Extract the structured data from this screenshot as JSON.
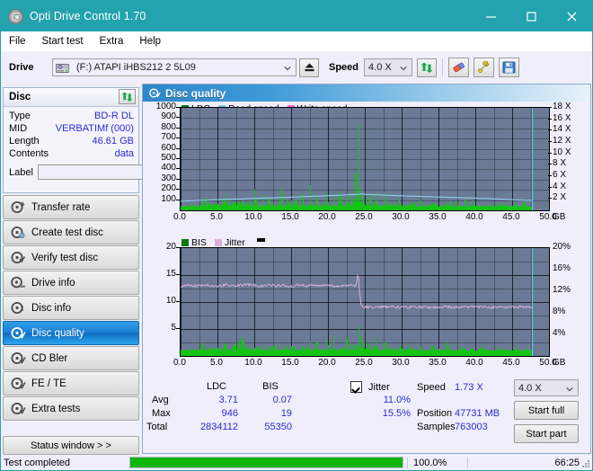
{
  "window": {
    "title": "Opti Drive Control 1.70",
    "icon": "disc-icon",
    "minimize": "−",
    "maximize": "□",
    "close": "✕"
  },
  "menu": {
    "items": [
      "File",
      "Start test",
      "Extra",
      "Help"
    ]
  },
  "toolbar": {
    "drive_label": "Drive",
    "drive_value": "(F:)  ATAPI iHBS212  2 5L09",
    "eject_icon": "eject-icon",
    "speed_label": "Speed",
    "speed_value": "4.0 X",
    "refresh_icon": "refresh-icon",
    "erase_icon": "eraser-icon",
    "tools_icon": "tools-icon",
    "save_icon": "save-icon"
  },
  "disc_panel": {
    "title": "Disc",
    "refresh_icon": "refresh-icon",
    "rows": [
      {
        "key": "Type",
        "value": "BD-R DL"
      },
      {
        "key": "MID",
        "value": "VERBATIMf (000)"
      },
      {
        "key": "Length",
        "value": "46.61 GB"
      },
      {
        "key": "Contents",
        "value": "data"
      }
    ],
    "label_key": "Label",
    "label_value": "",
    "label_placeholder": "",
    "label_button_icon": "disc-yellow-icon"
  },
  "sidebar": {
    "items": [
      {
        "label": "Transfer rate",
        "icon": "disc-arrow-icon",
        "selected": false
      },
      {
        "label": "Create test disc",
        "icon": "disc-write-icon",
        "selected": false
      },
      {
        "label": "Verify test disc",
        "icon": "disc-verify-icon",
        "selected": false
      },
      {
        "label": "Drive info",
        "icon": "drive-info-icon",
        "selected": false
      },
      {
        "label": "Disc info",
        "icon": "disc-info-icon",
        "selected": false
      },
      {
        "label": "Disc quality",
        "icon": "disc-quality-icon",
        "selected": true
      },
      {
        "label": "CD Bler",
        "icon": "disc-bler-icon",
        "selected": false
      },
      {
        "label": "FE / TE",
        "icon": "disc-fete-icon",
        "selected": false
      },
      {
        "label": "Extra tests",
        "icon": "disc-extra-icon",
        "selected": false
      }
    ],
    "status_window_button": "Status window > >"
  },
  "main": {
    "title": "Disc quality",
    "icon": "disc-quality-icon"
  },
  "stats": {
    "col_headers": [
      "LDC",
      "BIS"
    ],
    "row_headers": [
      "Avg",
      "Max",
      "Total"
    ],
    "ldc": {
      "avg": "3.71",
      "max": "946",
      "total": "2834112"
    },
    "bis": {
      "avg": "0.07",
      "max": "19",
      "total": "55350"
    },
    "jitter": {
      "label": "Jitter",
      "checked": true,
      "avg": "11.0%",
      "max": "15.5%"
    },
    "speed_label": "Speed",
    "speed_value": "1.73 X",
    "position_label": "Position",
    "position_value": "47731 MB",
    "samples_label": "Samples",
    "samples_value": "763003",
    "speed_select": "4.0 X",
    "start_full_button": "Start full",
    "start_part_button": "Start part"
  },
  "statusbar": {
    "message": "Test completed",
    "progress_percent": "100.0%",
    "progress_value": 100,
    "elapsed": "66:25"
  },
  "colors": {
    "accent": "#23a3ae",
    "ldc": "#14c414",
    "bis": "#14c414",
    "read_speed": "#8fd8f5",
    "write_speed": "#ff66dd",
    "jitter": "#d9b0d9",
    "value_text": "#2b2bd4",
    "plot_bg": "#6b7a96",
    "progress": "#0fb40f"
  },
  "chart_data": [
    {
      "type": "bar",
      "id": "ldc-chart",
      "title": "Disc quality",
      "legend": [
        {
          "label": "LDC",
          "color": "#0a7a0a"
        },
        {
          "label": "Read speed",
          "color": "#6fc8f0"
        },
        {
          "label": "Write speed",
          "color": "#ff66dd"
        }
      ],
      "legend_position": "top-left",
      "xlabel": "GB",
      "x_unit_label": "50.0 GB",
      "xlim": [
        0,
        50
      ],
      "xticks": [
        "0.0",
        "5.0",
        "10.0",
        "15.0",
        "20.0",
        "25.0",
        "30.0",
        "35.0",
        "40.0",
        "45.0",
        "50.0"
      ],
      "ylabel": "LDC",
      "ylim": [
        0,
        1000
      ],
      "yticks": [
        100,
        200,
        300,
        400,
        500,
        600,
        700,
        800,
        900,
        1000
      ],
      "y2label": "Speed",
      "y2lim": [
        0,
        18
      ],
      "y2ticks": [
        "2 X",
        "4 X",
        "6 X",
        "8 X",
        "10 X",
        "12 X",
        "14 X",
        "16 X",
        "18 X"
      ],
      "grid": true,
      "cursor_x": 47.7,
      "series": [
        {
          "name": "LDC",
          "color": "#14c414",
          "kind": "bars",
          "x": [
            0.2,
            0.5,
            0.9,
            1.3,
            1.7,
            2.1,
            2.4,
            2.8,
            3.2,
            3.6,
            4.0,
            4.4,
            4.8,
            5.2,
            5.6,
            6.0,
            6.4,
            6.8,
            7.2,
            7.6,
            8.0,
            8.4,
            8.8,
            9.2,
            9.6,
            10.0,
            10.4,
            10.8,
            11.2,
            11.6,
            12.0,
            12.4,
            12.8,
            13.2,
            13.6,
            14.0,
            14.4,
            14.8,
            15.2,
            15.6,
            16.0,
            16.4,
            16.8,
            17.2,
            17.6,
            18.0,
            18.4,
            18.8,
            19.2,
            19.6,
            20.0,
            20.4,
            20.8,
            21.2,
            21.6,
            22.0,
            22.4,
            22.8,
            23.2,
            23.6,
            23.9,
            24.1,
            24.3,
            24.5,
            24.7,
            24.9,
            25.1,
            25.4,
            25.8,
            26.2,
            26.6,
            27.0,
            27.4,
            27.8,
            28.2,
            28.6,
            29.0,
            29.4,
            29.8,
            30.2,
            30.6,
            31.0,
            31.4,
            31.8,
            32.2,
            32.6,
            33.0,
            33.4,
            33.8,
            34.2,
            34.6,
            35.0,
            35.4,
            35.8,
            36.2,
            36.6,
            37.0,
            37.4,
            37.8,
            38.2,
            38.6,
            39.0,
            39.4,
            39.8,
            40.2,
            40.6,
            41.0,
            41.4,
            41.8,
            42.2,
            42.6,
            43.0,
            43.4,
            43.8,
            44.2,
            44.6,
            45.0,
            45.4,
            45.8,
            46.2,
            46.6,
            47.0,
            47.4
          ],
          "values": [
            40,
            70,
            45,
            90,
            60,
            160,
            55,
            110,
            75,
            275,
            60,
            130,
            290,
            75,
            175,
            60,
            255,
            80,
            120,
            65,
            90,
            150,
            60,
            105,
            70,
            200,
            55,
            95,
            180,
            70,
            140,
            60,
            110,
            95,
            240,
            70,
            160,
            120,
            65,
            190,
            90,
            230,
            70,
            125,
            260,
            85,
            150,
            95,
            70,
            210,
            120,
            65,
            185,
            90,
            310,
            130,
            70,
            245,
            100,
            420,
            620,
            946,
            520,
            360,
            290,
            240,
            180,
            150,
            260,
            90,
            200,
            70,
            130,
            240,
            80,
            110,
            60,
            190,
            70,
            155,
            90,
            60,
            120,
            70,
            45,
            160,
            50,
            90,
            140,
            60,
            110,
            40,
            75,
            200,
            55,
            95,
            60,
            145,
            80,
            50,
            120,
            40,
            95,
            170,
            55,
            80,
            45,
            130,
            60,
            100,
            40,
            75,
            150,
            55,
            90,
            35,
            70,
            120,
            45,
            60,
            90,
            40,
            55
          ]
        },
        {
          "name": "Read speed",
          "color": "#8fd8f5",
          "kind": "line",
          "axis": "y2",
          "x": [
            0,
            2,
            4,
            6,
            8,
            10,
            12,
            14,
            16,
            18,
            20,
            22,
            23,
            24,
            24.4,
            24.6,
            25,
            27,
            29,
            31,
            33,
            35,
            37,
            39,
            41,
            43,
            45,
            46,
            47,
            47.5
          ],
          "values": [
            1.6,
            1.72,
            1.82,
            1.92,
            2.0,
            2.1,
            2.18,
            2.26,
            2.36,
            2.46,
            2.56,
            2.68,
            2.74,
            2.8,
            2.85,
            2.9,
            2.82,
            2.7,
            2.6,
            2.5,
            2.42,
            2.34,
            2.26,
            2.18,
            2.1,
            2.0,
            1.88,
            1.8,
            1.74,
            1.73
          ]
        }
      ]
    },
    {
      "type": "bar",
      "id": "bis-jitter-chart",
      "legend": [
        {
          "label": "BIS",
          "color": "#0a7a0a"
        },
        {
          "label": "Jitter",
          "color": "#d9b0d9"
        }
      ],
      "legend_position": "top-left",
      "xlabel": "GB",
      "x_unit_label": "50.0 GB",
      "xlim": [
        0,
        50
      ],
      "xticks": [
        "0.0",
        "5.0",
        "10.0",
        "15.0",
        "20.0",
        "25.0",
        "30.0",
        "35.0",
        "40.0",
        "45.0",
        "50.0"
      ],
      "ylabel": "BIS",
      "ylim": [
        0,
        20
      ],
      "yticks": [
        5,
        10,
        15,
        20
      ],
      "y2label": "Jitter",
      "y2lim": [
        0,
        20
      ],
      "y2ticks": [
        "4%",
        "8%",
        "12%",
        "16%",
        "20%"
      ],
      "grid": true,
      "cursor_x": 47.7,
      "series": [
        {
          "name": "BIS",
          "color": "#14c414",
          "kind": "bars",
          "x": [
            0.3,
            0.8,
            1.3,
            1.8,
            2.3,
            2.8,
            3.3,
            3.8,
            4.3,
            4.8,
            5.3,
            5.8,
            6.3,
            6.8,
            7.3,
            7.8,
            8.3,
            8.8,
            9.3,
            9.8,
            10.3,
            10.8,
            11.3,
            11.8,
            12.3,
            12.8,
            13.3,
            13.8,
            14.3,
            14.8,
            15.3,
            15.8,
            16.3,
            16.8,
            17.3,
            17.8,
            18.3,
            18.8,
            19.3,
            19.8,
            20.3,
            20.8,
            21.3,
            21.8,
            22.3,
            22.8,
            23.3,
            23.8,
            24.2,
            24.4,
            24.6,
            25.0,
            25.5,
            26.0,
            26.5,
            27.0,
            27.5,
            28.0,
            28.5,
            29.0,
            29.5,
            30.0,
            30.5,
            31.0,
            31.5,
            32.0,
            32.5,
            33.0,
            33.5,
            34.0,
            34.5,
            35.0,
            35.5,
            36.0,
            36.5,
            37.0,
            37.5,
            38.0,
            38.5,
            39.0,
            39.5,
            40.0,
            40.5,
            41.0,
            41.5,
            42.0,
            42.5,
            43.0,
            43.5,
            44.0,
            44.5,
            45.0,
            45.5,
            46.0,
            46.5,
            47.0,
            47.4
          ],
          "values": [
            1.2,
            1.6,
            1.1,
            2.2,
            1.4,
            3.0,
            1.3,
            2.0,
            1.5,
            5.9,
            1.2,
            2.4,
            2.0,
            1.3,
            3.2,
            1.5,
            5.8,
            1.4,
            2.1,
            1.2,
            1.8,
            2.8,
            1.3,
            1.9,
            1.4,
            3.6,
            1.2,
            1.7,
            3.1,
            1.3,
            2.5,
            1.2,
            2.0,
            1.7,
            4.2,
            1.3,
            2.9,
            2.2,
            1.2,
            3.4,
            1.6,
            4.1,
            1.3,
            2.2,
            4.6,
            1.5,
            2.7,
            1.7,
            6.0,
            7.0,
            5.0,
            3.2,
            4.0,
            1.6,
            3.6,
            1.3,
            2.3,
            4.3,
            1.4,
            2.0,
            1.1,
            3.4,
            1.3,
            2.8,
            1.6,
            1.1,
            2.2,
            1.3,
            1.0,
            2.9,
            1.2,
            1.6,
            1.1,
            3.6,
            1.0,
            1.7,
            1.1,
            2.6,
            1.4,
            1.0,
            2.2,
            1.2,
            1.7,
            3.1,
            1.0,
            1.5,
            1.0,
            2.4,
            1.1,
            1.8,
            1.0,
            1.3,
            2.2,
            1.0,
            1.1,
            1.6,
            1.0
          ]
        },
        {
          "name": "Jitter",
          "color": "#d9b0d9",
          "kind": "line",
          "axis": "y2",
          "x": [
            0.2,
            1,
            2,
            3,
            4,
            5,
            6,
            7,
            8,
            9,
            10,
            11,
            12,
            13,
            14,
            15,
            16,
            17,
            18,
            19,
            20,
            21,
            22,
            23,
            23.8,
            24.1,
            24.3,
            24.5,
            25,
            26,
            28,
            30,
            32,
            34,
            36,
            38,
            40,
            42,
            44,
            46,
            47.4
          ],
          "values": [
            12.9,
            13.1,
            13.0,
            13.2,
            13.1,
            12.9,
            13.2,
            13.0,
            13.1,
            13.3,
            13.1,
            12.9,
            13.2,
            13.0,
            13.1,
            12.9,
            13.2,
            13.0,
            13.1,
            13.0,
            13.2,
            12.9,
            13.1,
            13.2,
            13.0,
            15.5,
            12.0,
            9.2,
            9.1,
            9.0,
            9.1,
            9.0,
            9.1,
            9.0,
            9.1,
            9.0,
            9.1,
            9.0,
            9.0,
            9.1,
            9.0
          ]
        }
      ]
    }
  ]
}
